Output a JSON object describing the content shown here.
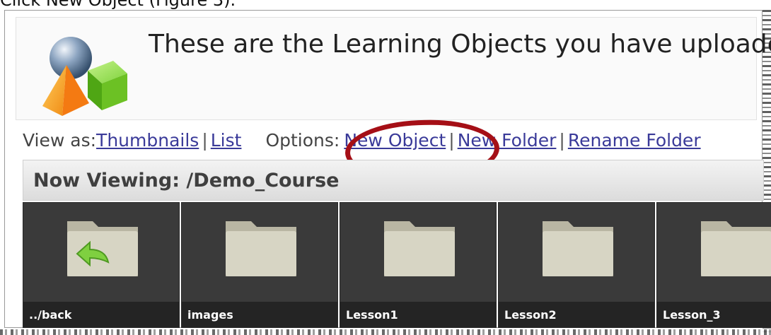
{
  "caption": "Click New Object (Figure 3).",
  "header": {
    "message": "These are the Learning Objects you have uploaded."
  },
  "toolbar": {
    "view_label": "View as:",
    "view_options": [
      "Thumbnails",
      "List"
    ],
    "options_label": "Options:",
    "options": [
      "New Object",
      "New Folder",
      "Rename Folder"
    ]
  },
  "location": {
    "text": "Now Viewing: /Demo_Course"
  },
  "folders": [
    {
      "name": "../back",
      "icon": "folder-back-icon"
    },
    {
      "name": "images",
      "icon": "folder-icon"
    },
    {
      "name": "Lesson1",
      "icon": "folder-icon"
    },
    {
      "name": "Lesson2",
      "icon": "folder-icon"
    },
    {
      "name": "Lesson_3",
      "icon": "folder-icon"
    }
  ],
  "colors": {
    "link": "#3a3a99",
    "highlight": "#a50f16",
    "tile_bg": "#3a3a3a",
    "folder": "#c9c6b3"
  }
}
